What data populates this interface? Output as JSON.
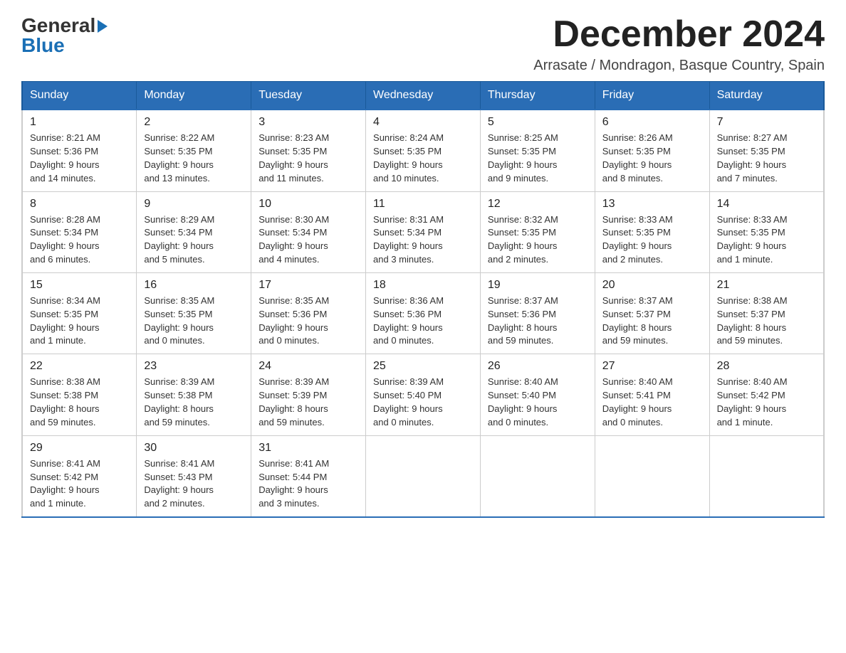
{
  "header": {
    "logo": {
      "general": "General",
      "blue": "Blue",
      "arrow": "▶"
    },
    "title": "December 2024",
    "subtitle": "Arrasate / Mondragon, Basque Country, Spain"
  },
  "days_of_week": [
    "Sunday",
    "Monday",
    "Tuesday",
    "Wednesday",
    "Thursday",
    "Friday",
    "Saturday"
  ],
  "weeks": [
    [
      {
        "day": "1",
        "info": "Sunrise: 8:21 AM\nSunset: 5:36 PM\nDaylight: 9 hours\nand 14 minutes."
      },
      {
        "day": "2",
        "info": "Sunrise: 8:22 AM\nSunset: 5:35 PM\nDaylight: 9 hours\nand 13 minutes."
      },
      {
        "day": "3",
        "info": "Sunrise: 8:23 AM\nSunset: 5:35 PM\nDaylight: 9 hours\nand 11 minutes."
      },
      {
        "day": "4",
        "info": "Sunrise: 8:24 AM\nSunset: 5:35 PM\nDaylight: 9 hours\nand 10 minutes."
      },
      {
        "day": "5",
        "info": "Sunrise: 8:25 AM\nSunset: 5:35 PM\nDaylight: 9 hours\nand 9 minutes."
      },
      {
        "day": "6",
        "info": "Sunrise: 8:26 AM\nSunset: 5:35 PM\nDaylight: 9 hours\nand 8 minutes."
      },
      {
        "day": "7",
        "info": "Sunrise: 8:27 AM\nSunset: 5:35 PM\nDaylight: 9 hours\nand 7 minutes."
      }
    ],
    [
      {
        "day": "8",
        "info": "Sunrise: 8:28 AM\nSunset: 5:34 PM\nDaylight: 9 hours\nand 6 minutes."
      },
      {
        "day": "9",
        "info": "Sunrise: 8:29 AM\nSunset: 5:34 PM\nDaylight: 9 hours\nand 5 minutes."
      },
      {
        "day": "10",
        "info": "Sunrise: 8:30 AM\nSunset: 5:34 PM\nDaylight: 9 hours\nand 4 minutes."
      },
      {
        "day": "11",
        "info": "Sunrise: 8:31 AM\nSunset: 5:34 PM\nDaylight: 9 hours\nand 3 minutes."
      },
      {
        "day": "12",
        "info": "Sunrise: 8:32 AM\nSunset: 5:35 PM\nDaylight: 9 hours\nand 2 minutes."
      },
      {
        "day": "13",
        "info": "Sunrise: 8:33 AM\nSunset: 5:35 PM\nDaylight: 9 hours\nand 2 minutes."
      },
      {
        "day": "14",
        "info": "Sunrise: 8:33 AM\nSunset: 5:35 PM\nDaylight: 9 hours\nand 1 minute."
      }
    ],
    [
      {
        "day": "15",
        "info": "Sunrise: 8:34 AM\nSunset: 5:35 PM\nDaylight: 9 hours\nand 1 minute."
      },
      {
        "day": "16",
        "info": "Sunrise: 8:35 AM\nSunset: 5:35 PM\nDaylight: 9 hours\nand 0 minutes."
      },
      {
        "day": "17",
        "info": "Sunrise: 8:35 AM\nSunset: 5:36 PM\nDaylight: 9 hours\nand 0 minutes."
      },
      {
        "day": "18",
        "info": "Sunrise: 8:36 AM\nSunset: 5:36 PM\nDaylight: 9 hours\nand 0 minutes."
      },
      {
        "day": "19",
        "info": "Sunrise: 8:37 AM\nSunset: 5:36 PM\nDaylight: 8 hours\nand 59 minutes."
      },
      {
        "day": "20",
        "info": "Sunrise: 8:37 AM\nSunset: 5:37 PM\nDaylight: 8 hours\nand 59 minutes."
      },
      {
        "day": "21",
        "info": "Sunrise: 8:38 AM\nSunset: 5:37 PM\nDaylight: 8 hours\nand 59 minutes."
      }
    ],
    [
      {
        "day": "22",
        "info": "Sunrise: 8:38 AM\nSunset: 5:38 PM\nDaylight: 8 hours\nand 59 minutes."
      },
      {
        "day": "23",
        "info": "Sunrise: 8:39 AM\nSunset: 5:38 PM\nDaylight: 8 hours\nand 59 minutes."
      },
      {
        "day": "24",
        "info": "Sunrise: 8:39 AM\nSunset: 5:39 PM\nDaylight: 8 hours\nand 59 minutes."
      },
      {
        "day": "25",
        "info": "Sunrise: 8:39 AM\nSunset: 5:40 PM\nDaylight: 9 hours\nand 0 minutes."
      },
      {
        "day": "26",
        "info": "Sunrise: 8:40 AM\nSunset: 5:40 PM\nDaylight: 9 hours\nand 0 minutes."
      },
      {
        "day": "27",
        "info": "Sunrise: 8:40 AM\nSunset: 5:41 PM\nDaylight: 9 hours\nand 0 minutes."
      },
      {
        "day": "28",
        "info": "Sunrise: 8:40 AM\nSunset: 5:42 PM\nDaylight: 9 hours\nand 1 minute."
      }
    ],
    [
      {
        "day": "29",
        "info": "Sunrise: 8:41 AM\nSunset: 5:42 PM\nDaylight: 9 hours\nand 1 minute."
      },
      {
        "day": "30",
        "info": "Sunrise: 8:41 AM\nSunset: 5:43 PM\nDaylight: 9 hours\nand 2 minutes."
      },
      {
        "day": "31",
        "info": "Sunrise: 8:41 AM\nSunset: 5:44 PM\nDaylight: 9 hours\nand 3 minutes."
      },
      {
        "day": "",
        "info": ""
      },
      {
        "day": "",
        "info": ""
      },
      {
        "day": "",
        "info": ""
      },
      {
        "day": "",
        "info": ""
      }
    ]
  ]
}
